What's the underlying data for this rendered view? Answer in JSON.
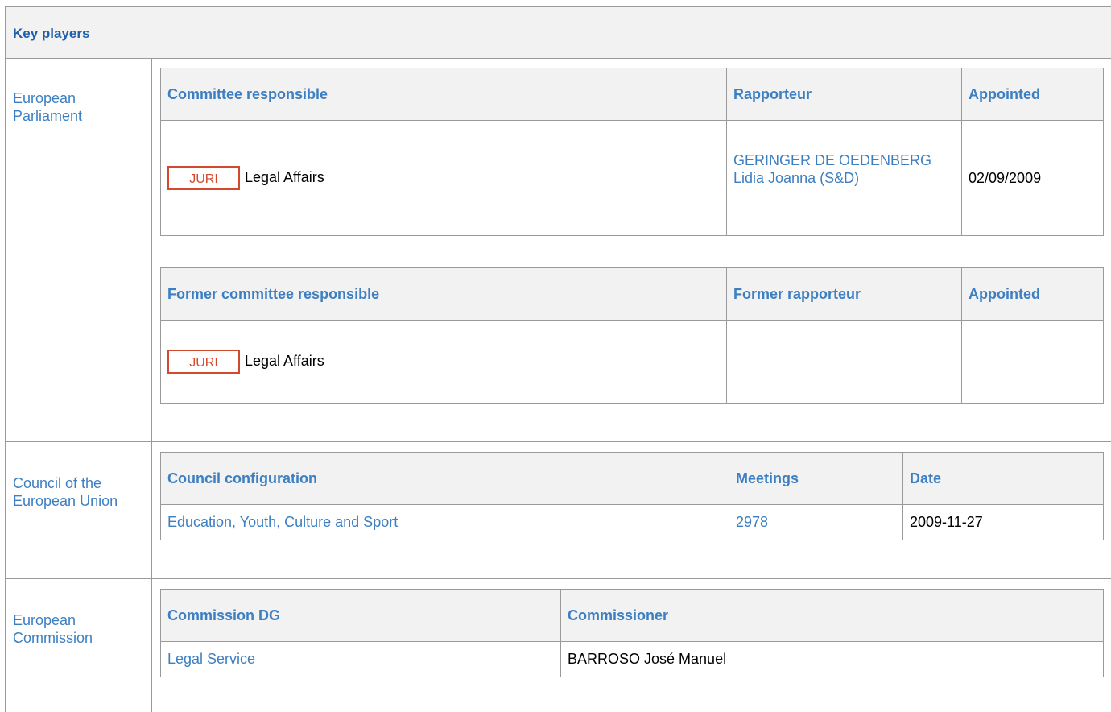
{
  "section": {
    "title": "Key players"
  },
  "parliament": {
    "label": "European Parliament",
    "current": {
      "headers": {
        "committee": "Committee responsible",
        "rapporteur": "Rapporteur",
        "appointed": "Appointed"
      },
      "row": {
        "badge": "JURI",
        "committee_name": "Legal Affairs",
        "rapporteur": "GERINGER DE OEDENBERG Lidia Joanna (S&D)",
        "appointed": "02/09/2009"
      }
    },
    "former": {
      "headers": {
        "committee": "Former committee responsible",
        "rapporteur": "Former rapporteur",
        "appointed": "Appointed"
      },
      "row": {
        "badge": "JURI",
        "committee_name": "Legal Affairs",
        "rapporteur": "",
        "appointed": ""
      }
    }
  },
  "council": {
    "label": "Council of the European Union",
    "headers": {
      "configuration": "Council configuration",
      "meetings": "Meetings",
      "date": "Date"
    },
    "row": {
      "configuration": "Education, Youth, Culture and Sport",
      "meetings": "2978",
      "date": "2009-11-27"
    }
  },
  "commission": {
    "label": "European Commission",
    "headers": {
      "dg": "Commission DG",
      "commissioner": "Commissioner"
    },
    "row": {
      "dg": "Legal Service",
      "commissioner": "BARROSO José Manuel"
    }
  }
}
